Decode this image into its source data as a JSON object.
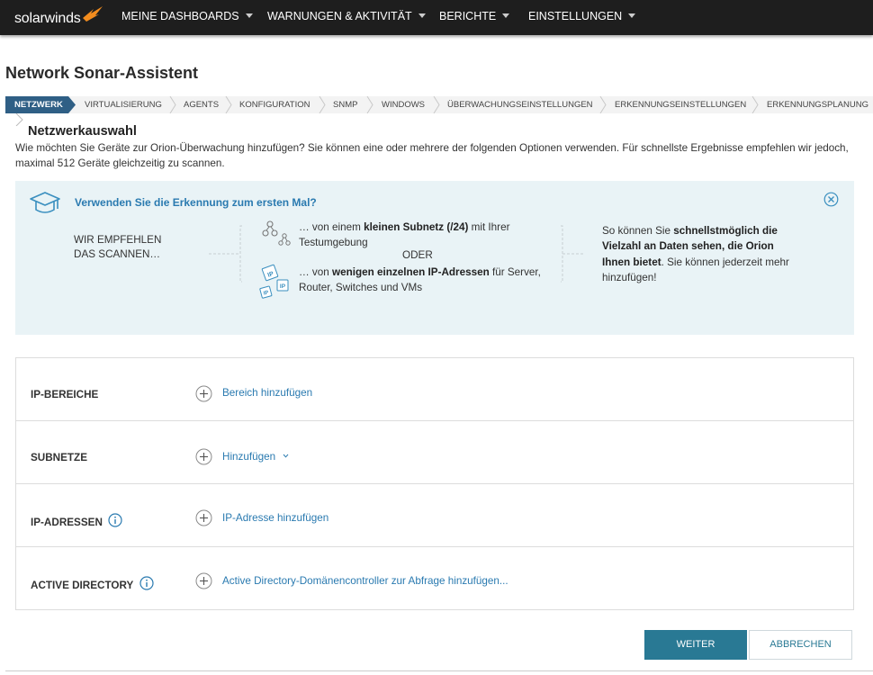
{
  "brand": {
    "name": "solarwinds",
    "accent": "#f28c1e"
  },
  "nav": {
    "items": [
      {
        "label": "MEINE DASHBOARDS"
      },
      {
        "label": "WARNUNGEN & AKTIVITÄT"
      },
      {
        "label": "BERICHTE"
      },
      {
        "label": "EINSTELLUNGEN"
      }
    ]
  },
  "page": {
    "title": "Network Sonar-Assistent"
  },
  "wizard": {
    "steps": [
      {
        "label": "NETZWERK",
        "active": true
      },
      {
        "label": "VIRTUALISIERUNG"
      },
      {
        "label": "AGENTS"
      },
      {
        "label": "KONFIGURATION"
      },
      {
        "label": "SNMP"
      },
      {
        "label": "WINDOWS"
      },
      {
        "label": "ÜBERWACHUNGSEINSTELLUNGEN"
      },
      {
        "label": "ERKENNUNGSEINSTELLUNGEN"
      },
      {
        "label": "ERKENNUNGSPLANUNG"
      }
    ]
  },
  "section": {
    "title": "Netzwerkauswahl",
    "intro": "Wie möchten Sie Geräte zur Orion-Überwachung hinzufügen? Sie können eine oder mehrere der folgenden Optionen verwenden. Für schnellste Ergebnisse empfehlen wir jedoch, maximal  512 Geräte gleichzeitig zu scannen."
  },
  "banner": {
    "title": "Verwenden Sie die Erkennung zum ersten Mal?",
    "recommend_line1": "WIR EMPFEHLEN",
    "recommend_line2": "DAS SCANNEN…",
    "option1_pre": "… von einem ",
    "option1_bold": "kleinen Subnetz (/24)",
    "option1_post": " mit Ihrer Testumgebung",
    "or": "ODER",
    "option2_pre": "… von ",
    "option2_bold": "wenigen einzelnen IP-Adressen",
    "option2_post": " für Server, Router, Switches und VMs",
    "right_pre": "So können Sie ",
    "right_bold": "schnellstmöglich die Vielzahl an Daten sehen, die Orion Ihnen bietet",
    "right_post": ". Sie können jederzeit mehr hinzufügen!",
    "background": "#e9f3f6",
    "title_color": "#2a7ab0"
  },
  "form": {
    "rows": [
      {
        "label": "IP-BEREICHE",
        "action": "Bereich hinzufügen"
      },
      {
        "label": "SUBNETZE",
        "action": "Hinzufügen"
      },
      {
        "label": "IP-ADRESSEN",
        "action": "IP-Adresse hinzufügen"
      },
      {
        "label": "ACTIVE DIRECTORY",
        "action": "Active Directory-Domänencontroller zur Abfrage hinzufügen..."
      }
    ]
  },
  "buttons": {
    "next": "WEITER",
    "cancel": "ABBRECHEN",
    "primary_color": "#297994"
  },
  "icons": {
    "logo": "solarwinds-bird-icon",
    "banner": "graduation-cap-icon",
    "close": "close-circle-icon",
    "subnet": "network-topology-icon",
    "ip": "ip-tag-icon",
    "add": "plus-circle-icon",
    "info": "info-circle-icon"
  }
}
